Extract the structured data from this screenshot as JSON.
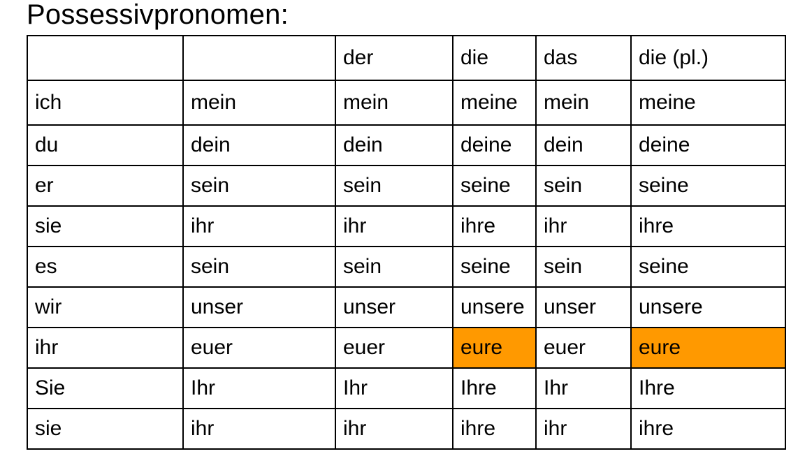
{
  "title": "Possessivpronomen:",
  "highlight_color": "#ff9900",
  "table": {
    "header": [
      "",
      "",
      "der",
      "die",
      "das",
      "die (pl.)"
    ],
    "rows": [
      [
        "ich",
        "mein",
        "mein",
        "meine",
        "mein",
        "meine"
      ],
      [
        "du",
        "dein",
        "dein",
        "deine",
        "dein",
        "deine"
      ],
      [
        "er",
        "sein",
        "sein",
        "seine",
        "sein",
        "seine"
      ],
      [
        "sie",
        "ihr",
        "ihr",
        "ihre",
        "ihr",
        "ihre"
      ],
      [
        "es",
        "sein",
        "sein",
        "seine",
        "sein",
        "seine"
      ],
      [
        "wir",
        "unser",
        "unser",
        "unsere",
        "unser",
        "unsere"
      ],
      [
        "ihr",
        "euer",
        "euer",
        "eure",
        "euer",
        "eure"
      ],
      [
        "Sie",
        "Ihr",
        "Ihr",
        "Ihre",
        "Ihr",
        "Ihre"
      ],
      [
        "sie",
        "ihr",
        "ihr",
        "ihre",
        "ihr",
        "ihre"
      ]
    ],
    "highlighted_cells": [
      {
        "row": 6,
        "col": 3
      },
      {
        "row": 6,
        "col": 5
      }
    ]
  }
}
